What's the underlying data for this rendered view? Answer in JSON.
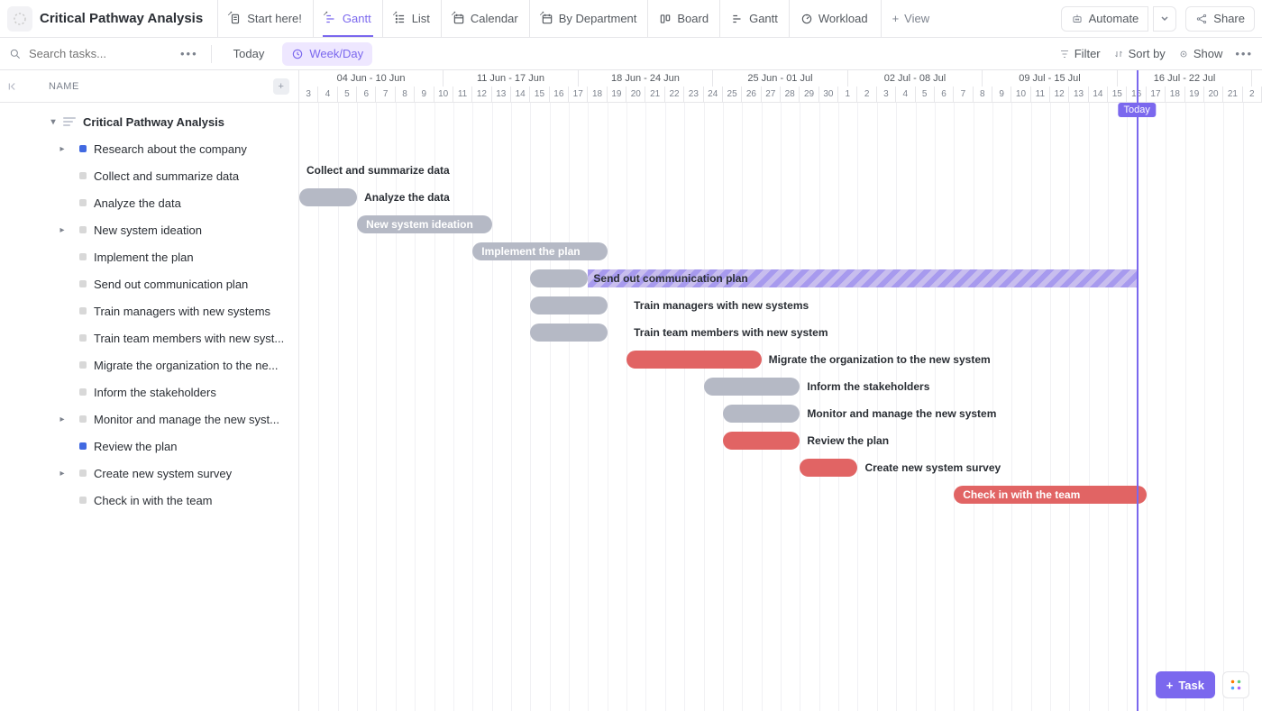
{
  "header": {
    "title": "Critical Pathway Analysis",
    "tabs": [
      {
        "label": "Start here!",
        "pinned": true,
        "icon": "doc"
      },
      {
        "label": "Gantt",
        "pinned": true,
        "icon": "gantt",
        "active": true
      },
      {
        "label": "List",
        "pinned": true,
        "icon": "list"
      },
      {
        "label": "Calendar",
        "pinned": true,
        "icon": "calendar"
      },
      {
        "label": "By Department",
        "pinned": true,
        "icon": "calendar"
      },
      {
        "label": "Board",
        "pinned": false,
        "icon": "board"
      },
      {
        "label": "Gantt",
        "pinned": false,
        "icon": "gantt"
      },
      {
        "label": "Workload",
        "pinned": false,
        "icon": "workload"
      }
    ],
    "add_view": "View",
    "automate": "Automate",
    "share": "Share"
  },
  "subbar": {
    "search_placeholder": "Search tasks...",
    "today": "Today",
    "weekday": "Week/Day",
    "filter": "Filter",
    "sortby": "Sort by",
    "show": "Show"
  },
  "left": {
    "header": "NAME",
    "group": "Critical Pathway Analysis",
    "tasks": [
      {
        "label": "Research about the company",
        "caret": true,
        "status": "blue"
      },
      {
        "label": "Collect and summarize data"
      },
      {
        "label": "Analyze the data"
      },
      {
        "label": "New system ideation",
        "caret": true
      },
      {
        "label": "Implement the plan"
      },
      {
        "label": "Send out communication plan"
      },
      {
        "label": "Train managers with new systems"
      },
      {
        "label": "Train team members with new syst..."
      },
      {
        "label": "Migrate the organization to the ne..."
      },
      {
        "label": "Inform the stakeholders"
      },
      {
        "label": "Monitor and manage the new syst...",
        "caret": true
      },
      {
        "label": "Review the plan",
        "status": "blue"
      },
      {
        "label": "Create new system survey",
        "caret": true
      },
      {
        "label": "Check in with the team"
      }
    ]
  },
  "timeline": {
    "weeks": [
      "04 Jun - 10 Jun",
      "11 Jun - 17 Jun",
      "18 Jun - 24 Jun",
      "25 Jun - 01 Jul",
      "02 Jul - 08 Jul",
      "09 Jul - 15 Jul",
      "16 Jul - 22 Jul"
    ],
    "days": [
      "3",
      "4",
      "5",
      "6",
      "7",
      "8",
      "9",
      "10",
      "11",
      "12",
      "13",
      "14",
      "15",
      "16",
      "17",
      "18",
      "19",
      "20",
      "21",
      "22",
      "23",
      "24",
      "25",
      "26",
      "27",
      "28",
      "29",
      "30",
      "1",
      "2",
      "3",
      "4",
      "5",
      "6",
      "7",
      "8",
      "9",
      "10",
      "11",
      "12",
      "13",
      "14",
      "15",
      "16",
      "17",
      "18",
      "19",
      "20",
      "21",
      "2"
    ],
    "today_label": "Today",
    "today_index": 44,
    "day_width": 21.36
  },
  "bars": [
    {
      "row": 2,
      "label": "Collect and summarize data",
      "labelOnly": true,
      "labelX": 8
    },
    {
      "row": 3,
      "start": 0,
      "end": 3,
      "color": "graydark",
      "label": "Analyze the data",
      "labelOutside": true
    },
    {
      "row": 4,
      "start": 3,
      "end": 10,
      "color": "graydark",
      "label": "New system ideation",
      "labelInside": true,
      "followStripe": {
        "end": 11
      }
    },
    {
      "row": 5,
      "start": 9,
      "end": 16,
      "color": "graydark",
      "label": "Implement the plan",
      "labelInside": true
    },
    {
      "row": 6,
      "start": 12,
      "end": 15,
      "color": "graydark",
      "label": "Send out communication plan",
      "labelCenter": true,
      "stripeTo": 44
    },
    {
      "row": 7,
      "start": 12,
      "end": 16,
      "color": "graydark",
      "label": "Train managers with new systems",
      "labelOutside": true,
      "stripeSmall": true
    },
    {
      "row": 8,
      "start": 12,
      "end": 16,
      "color": "graydark",
      "label": "Train team members with new system",
      "labelOutside": true,
      "stripeSmall": true
    },
    {
      "row": 9,
      "start": 17,
      "end": 24,
      "color": "red",
      "label": "Migrate the organization to the new system",
      "labelOutside": true
    },
    {
      "row": 10,
      "start": 21,
      "end": 26,
      "color": "graydark",
      "label": "Inform the stakeholders",
      "labelOutside": true
    },
    {
      "row": 11,
      "start": 22,
      "end": 26,
      "color": "graydark",
      "label": "Monitor and manage the new system",
      "labelOutside": true
    },
    {
      "row": 12,
      "start": 22,
      "end": 26,
      "color": "red",
      "label": "Review the plan",
      "labelOutside": true
    },
    {
      "row": 13,
      "start": 26,
      "end": 29,
      "color": "red",
      "label": "Create new system survey",
      "labelOutside": true
    },
    {
      "row": 14,
      "start": 34,
      "end": 44,
      "color": "red",
      "label": "Check in with the team",
      "labelInside": true
    }
  ],
  "float": {
    "task": "Task"
  }
}
